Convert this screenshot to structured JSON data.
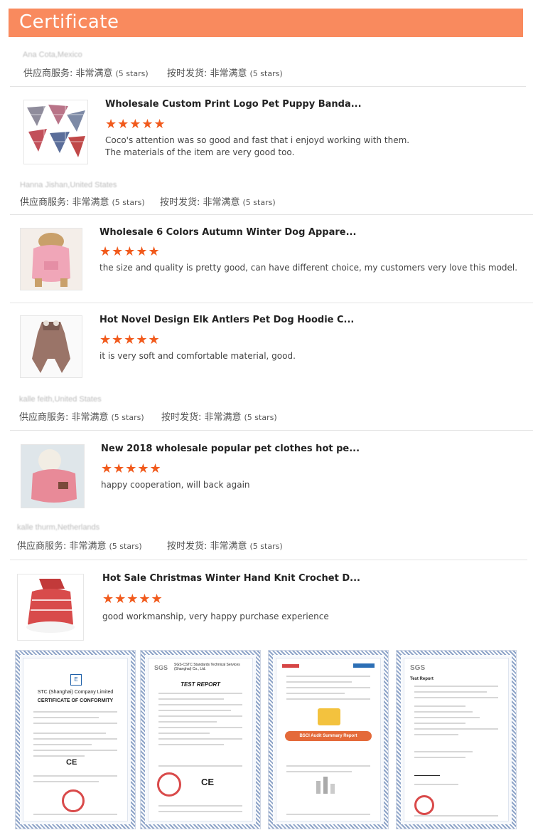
{
  "banner": {
    "title": "Certificate"
  },
  "reviews": [
    {
      "reviewer": "Ana Cota,Mexico",
      "supplier_label": "供应商服务: 非常满意",
      "supplier_stars": "(5 stars)",
      "shipping_label": "按时发货: 非常满意",
      "shipping_stars": "(5 stars)",
      "products": [
        {
          "title": "Wholesale Custom Print Logo Pet Puppy Banda...",
          "stars": "★★★★★",
          "comment_lines": [
            "Coco's attention was so good and fast that i enjoyd working with them.",
            "The materials of the item are very good too."
          ]
        }
      ]
    },
    {
      "reviewer": "Hanna Jishan,United States",
      "supplier_label": "供应商服务: 非常满意",
      "supplier_stars": "(5 stars)",
      "shipping_label": "按时发货: 非常满意",
      "shipping_stars": "(5 stars)",
      "products": [
        {
          "title": "Wholesale 6 Colors Autumn Winter Dog Appare...",
          "stars": "★★★★★",
          "comment_lines": [
            "the size and quality is pretty good, can have different choice, my customers very love this model."
          ]
        },
        {
          "title": "Hot Novel Design Elk Antlers Pet Dog Hoodie C...",
          "stars": "★★★★★",
          "comment_lines": [
            "it is very soft and comfortable material, good."
          ]
        }
      ]
    },
    {
      "reviewer": "kalle feith,United States",
      "supplier_label": "供应商服务: 非常满意",
      "supplier_stars": "(5 stars)",
      "shipping_label": "按时发货: 非常满意",
      "shipping_stars": "(5 stars)",
      "products": [
        {
          "title": "New 2018 wholesale popular pet clothes hot pe...",
          "stars": "★★★★★",
          "comment_lines": [
            "happy cooperation, will back again"
          ]
        }
      ]
    },
    {
      "reviewer": "kalle thurm,Netherlands",
      "supplier_label": "供应商服务: 非常满意",
      "supplier_stars": "(5 stars)",
      "shipping_label": "按时发货: 非常满意",
      "shipping_stars": "(5 stars)",
      "products": [
        {
          "title": "Hot Sale Christmas Winter Hand Knit Crochet D...",
          "stars": "★★★★★",
          "comment_lines": [
            "good workmanship, very happy purchase experience"
          ]
        }
      ]
    }
  ],
  "certificates": [
    {
      "heading": "STC (Shanghai) Company Limited",
      "title": "CERTIFICATE OF CONFORMITY"
    },
    {
      "heading": "SGS-CSTC Standards Technical Services (Shanghai) Co., Ltd.",
      "title": "TEST REPORT"
    },
    {
      "heading": "",
      "title": "BSCI Audit Summary Report"
    },
    {
      "heading": "SGS",
      "title": "Test Report"
    }
  ],
  "colors": {
    "banner": "#f98a5e",
    "stars": "#f15a1c"
  }
}
